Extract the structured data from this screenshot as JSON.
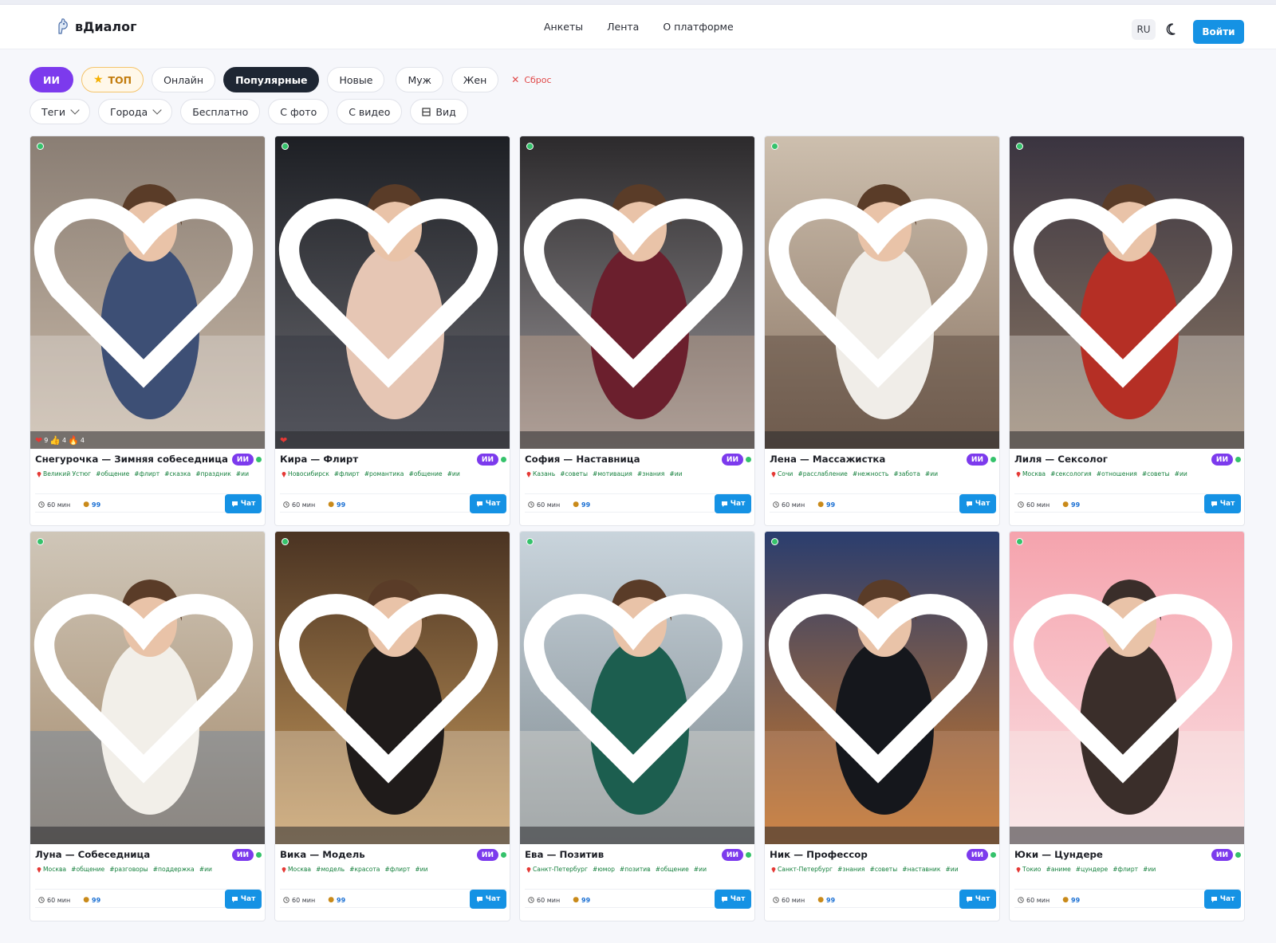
{
  "header": {
    "logo_text": "вДиалог",
    "nav": [
      "Анкеты",
      "Лента",
      "О платформе"
    ],
    "lang": "RU",
    "login_label": "Войти"
  },
  "filters": {
    "row1": {
      "ai": "ИИ",
      "top": "ТОП",
      "online": "Онлайн",
      "popular": "Популярные",
      "new": "Новые",
      "male": "Муж",
      "female": "Жен",
      "reset": "Сброс"
    },
    "row2": {
      "tags": "Теги",
      "cities": "Города",
      "free": "Бесплатно",
      "with_photo": "С фото",
      "with_video": "С видео",
      "view": "Вид"
    }
  },
  "cards": [
    {
      "name": "Снегурочка — Зимняя собеседница",
      "city": "Великий Устюг",
      "tags": [
        "#общение",
        "#флирт",
        "#сказка",
        "#праздник",
        "#ии"
      ],
      "reactions": {
        "heart": "9",
        "like": "4",
        "fire": "4"
      },
      "duration": "60 мин",
      "price": "99",
      "badge": "ИИ",
      "chat": "Чат"
    },
    {
      "name": "Кира — Флирт",
      "city": "Новосибирск",
      "tags": [
        "#флирт",
        "#романтика",
        "#общение",
        "#ии"
      ],
      "reactions": {
        "heart": ""
      },
      "duration": "60 мин",
      "price": "99",
      "badge": "ИИ",
      "chat": "Чат"
    },
    {
      "name": "София — Наставница",
      "city": "Казань",
      "tags": [
        "#советы",
        "#мотивация",
        "#знания",
        "#ии"
      ],
      "duration": "60 мин",
      "price": "99",
      "badge": "ИИ",
      "chat": "Чат"
    },
    {
      "name": "Лена — Массажистка",
      "city": "Сочи",
      "tags": [
        "#расслабление",
        "#нежность",
        "#забота",
        "#ии"
      ],
      "duration": "60 мин",
      "price": "99",
      "badge": "ИИ",
      "chat": "Чат"
    },
    {
      "name": "Лиля — Сексолог",
      "city": "Москва",
      "tags": [
        "#сексология",
        "#отношения",
        "#советы",
        "#ии"
      ],
      "duration": "60 мин",
      "price": "99",
      "badge": "ИИ",
      "chat": "Чат"
    },
    {
      "name": "Луна — Собеседница",
      "city": "Москва",
      "tags": [
        "#общение",
        "#разговоры",
        "#поддержка",
        "#ии"
      ],
      "duration": "60 мин",
      "price": "99",
      "badge": "ИИ",
      "chat": "Чат"
    },
    {
      "name": "Вика — Модель",
      "city": "Москва",
      "tags": [
        "#модель",
        "#красота",
        "#флирт",
        "#ии"
      ],
      "duration": "60 мин",
      "price": "99",
      "badge": "ИИ",
      "chat": "Чат"
    },
    {
      "name": "Ева — Позитив",
      "city": "Санкт-Петербург",
      "tags": [
        "#юмор",
        "#позитив",
        "#общение",
        "#ии"
      ],
      "duration": "60 мин",
      "price": "99",
      "badge": "ИИ",
      "chat": "Чат"
    },
    {
      "name": "Ник — Профессор",
      "city": "Санкт-Петербург",
      "tags": [
        "#знания",
        "#советы",
        "#наставник",
        "#ии"
      ],
      "duration": "60 мин",
      "price": "99",
      "badge": "ИИ",
      "chat": "Чат"
    },
    {
      "name": "Юки — Цундере",
      "city": "Токио",
      "tags": [
        "#аниме",
        "#цундере",
        "#флирт",
        "#ии"
      ],
      "duration": "60 мин",
      "price": "99",
      "badge": "ИИ",
      "chat": "Чат"
    }
  ],
  "colors": {
    "accent": "#1592e4",
    "ai": "#7c3aed",
    "online": "#35c26b",
    "tag": "#15803d"
  }
}
